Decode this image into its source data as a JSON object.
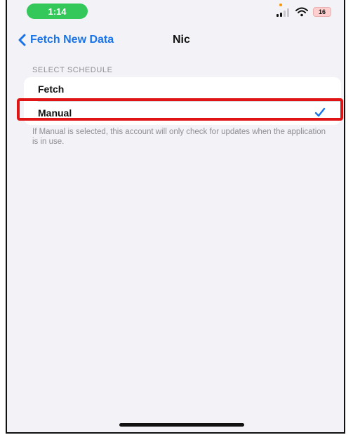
{
  "status_bar": {
    "time": "1:14",
    "battery": "16",
    "icons": [
      "signal-icon",
      "wifi-icon",
      "battery-icon"
    ],
    "colors": {
      "time_pill": "#34c759",
      "battery": "#ffcfcf"
    }
  },
  "nav": {
    "back_label": "Fetch New Data",
    "title": "Nic"
  },
  "schedule": {
    "header": "SELECT SCHEDULE",
    "options": [
      {
        "label": "Fetch",
        "selected": false
      },
      {
        "label": "Manual",
        "selected": true
      }
    ],
    "footer": "If Manual is selected, this account will only check for updates when the application is in use."
  },
  "annotation": {
    "highlight_color": "#e01414"
  },
  "accent_color": "#1a73e8"
}
